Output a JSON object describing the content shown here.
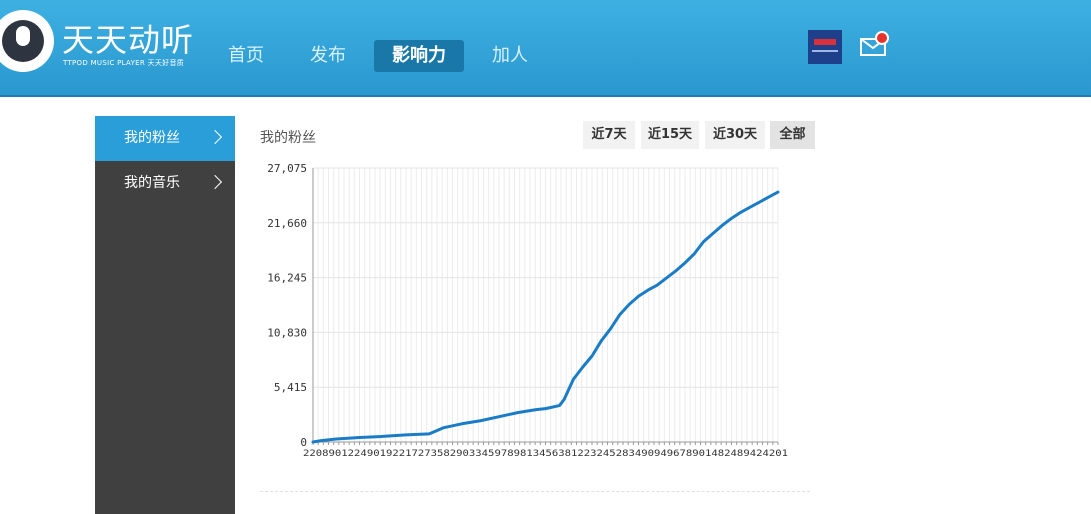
{
  "app": {
    "brand_name": "天天动听",
    "brand_sub": "TTPOD MUSIC PLAYER 天天好音质",
    "logo_text": "TTPOD"
  },
  "nav": {
    "items": [
      {
        "label": "首页",
        "active": false
      },
      {
        "label": "发布",
        "active": false
      },
      {
        "label": "影响力",
        "active": true
      },
      {
        "label": "加人",
        "active": false
      }
    ]
  },
  "header_icons": {
    "avatar": "user-avatar",
    "mail": "mail-icon",
    "mail_badge_color": "#e8332c"
  },
  "sidebar": {
    "items": [
      {
        "label": "我的粉丝",
        "active": true
      },
      {
        "label": "我的音乐",
        "active": false
      }
    ]
  },
  "main": {
    "title": "我的粉丝",
    "ranges": [
      {
        "label": "近7天",
        "active": false
      },
      {
        "label": "近15天",
        "active": false
      },
      {
        "label": "近30天",
        "active": false
      },
      {
        "label": "全部",
        "active": true
      }
    ]
  },
  "colors": {
    "header": "#2fa3d9",
    "sidebar": "#404040",
    "accent": "#2a9ed8",
    "line": "#1a7cc6"
  },
  "chart_data": {
    "type": "line",
    "title": "",
    "xlabel": "",
    "ylabel": "",
    "ylim": [
      0,
      27075
    ],
    "yticks": [
      0,
      5415,
      10830,
      16245,
      21660,
      27075
    ],
    "ytick_labels": [
      "0",
      "5,415",
      "10,830",
      "16,245",
      "21,660",
      "27,075"
    ],
    "xlim": [
      0,
      80
    ],
    "grid": true,
    "first_x_label": "22",
    "last_x_label": "01",
    "series": [
      {
        "values": [
          [
            0,
            0
          ],
          [
            2,
            150
          ],
          [
            5,
            300
          ],
          [
            10,
            450
          ],
          [
            15,
            550
          ],
          [
            20,
            700
          ],
          [
            25,
            800
          ],
          [
            28,
            1400
          ],
          [
            32,
            1800
          ],
          [
            36,
            2100
          ],
          [
            40,
            2500
          ],
          [
            44,
            2900
          ],
          [
            48,
            3200
          ],
          [
            50,
            3300
          ],
          [
            53,
            3600
          ],
          [
            54,
            4200
          ],
          [
            55,
            5200
          ],
          [
            56,
            6200
          ],
          [
            58,
            7400
          ],
          [
            60,
            8500
          ],
          [
            62,
            10000
          ],
          [
            64,
            11200
          ],
          [
            66,
            12600
          ],
          [
            68,
            13600
          ],
          [
            70,
            14400
          ],
          [
            72,
            15000
          ],
          [
            74,
            15500
          ],
          [
            76,
            16200
          ],
          [
            78,
            16900
          ],
          [
            80,
            17700
          ],
          [
            82,
            18600
          ],
          [
            84,
            19800
          ],
          [
            86,
            20600
          ],
          [
            88,
            21400
          ],
          [
            90,
            22100
          ],
          [
            92,
            22700
          ],
          [
            94,
            23200
          ],
          [
            96,
            23700
          ],
          [
            98,
            24200
          ],
          [
            100,
            24700
          ]
        ]
      }
    ]
  }
}
